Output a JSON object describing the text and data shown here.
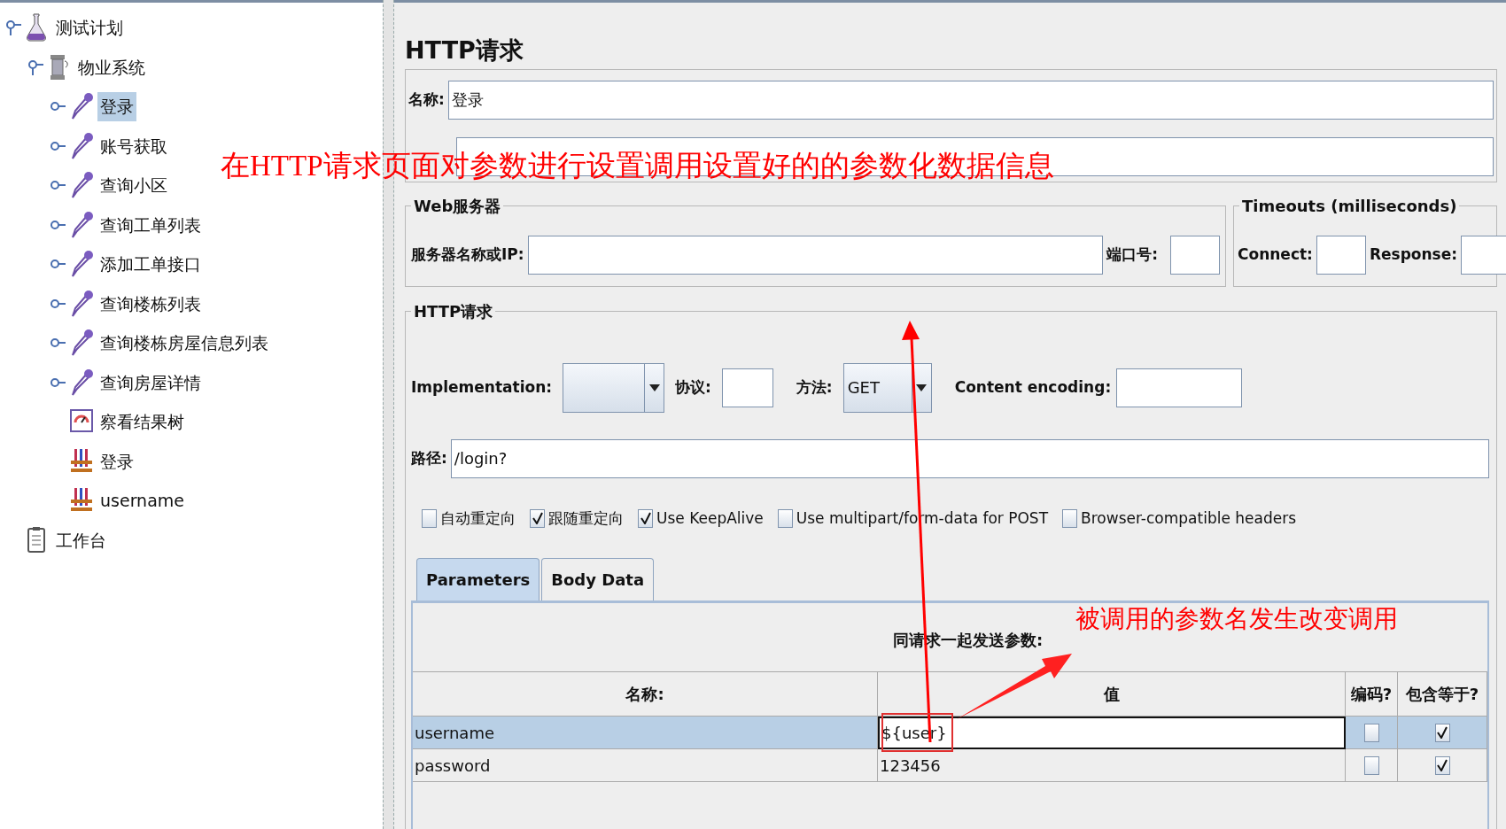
{
  "tree": [
    {
      "label": "测试计划",
      "kind": "plan",
      "expanded": true,
      "selected": false,
      "children": [
        {
          "label": "物业系统",
          "kind": "thread-group",
          "expanded": true,
          "selected": false,
          "children": [
            {
              "label": "登录",
              "kind": "sampler",
              "expanded": false,
              "selected": true
            },
            {
              "label": "账号获取",
              "kind": "sampler",
              "expanded": false,
              "selected": false
            },
            {
              "label": "查询小区",
              "kind": "sampler",
              "expanded": false,
              "selected": false
            },
            {
              "label": "查询工单列表",
              "kind": "sampler",
              "expanded": false,
              "selected": false
            },
            {
              "label": "添加工单接口",
              "kind": "sampler",
              "expanded": false,
              "selected": false
            },
            {
              "label": "查询楼栋列表",
              "kind": "sampler",
              "expanded": false,
              "selected": false
            },
            {
              "label": "查询楼栋房屋信息列表",
              "kind": "sampler",
              "expanded": false,
              "selected": false
            },
            {
              "label": "查询房屋详情",
              "kind": "sampler",
              "expanded": false,
              "selected": false
            },
            {
              "label": "察看结果树",
              "kind": "listener",
              "selected": false
            },
            {
              "label": "登录",
              "kind": "config",
              "selected": false
            },
            {
              "label": "username",
              "kind": "config",
              "selected": false
            }
          ]
        }
      ]
    },
    {
      "label": "工作台",
      "kind": "workbench",
      "selected": false
    }
  ],
  "panel": {
    "title": "HTTP请求",
    "name": {
      "label": "名称:",
      "value": "登录"
    },
    "web_server": {
      "legend": "Web服务器",
      "server_label": "服务器名称或IP:",
      "port_label": "端口号:"
    },
    "timeouts": {
      "legend": "Timeouts (milliseconds)",
      "connect_label": "Connect:",
      "response_label": "Response:"
    },
    "http_request": {
      "legend": "HTTP请求",
      "implementation_label": "Implementation:",
      "protocol_label": "协议:",
      "method_label": "方法:",
      "method_value": "GET",
      "encoding_label": "Content encoding:",
      "path_label": "路径:",
      "path_value": "/login?"
    },
    "options": [
      {
        "label": "自动重定向",
        "checked": false
      },
      {
        "label": "跟随重定向",
        "checked": true
      },
      {
        "label": "Use KeepAlive",
        "checked": true
      },
      {
        "label": "Use multipart/form-data for POST",
        "checked": false
      },
      {
        "label": "Browser-compatible headers",
        "checked": false
      }
    ],
    "tabs": [
      {
        "label": "Parameters",
        "selected": true
      },
      {
        "label": "Body Data",
        "selected": false
      }
    ],
    "parameters": {
      "caption": "同请求一起发送参数:",
      "columns": [
        "名称:",
        "值",
        "编码?",
        "包含等于?"
      ],
      "rows": [
        {
          "name": "username",
          "value": "${user}",
          "encode": false,
          "include_equals": true,
          "selected": true
        },
        {
          "name": "password",
          "value": "123456",
          "encode": false,
          "include_equals": true,
          "selected": false
        }
      ]
    }
  },
  "annotations": [
    {
      "kind": "headline",
      "text": "在HTTP请求页面对参数进行设置调用设置好的的参数化数据信息"
    },
    {
      "kind": "callout",
      "text": "被调用的参数名发生改变调用"
    }
  ]
}
